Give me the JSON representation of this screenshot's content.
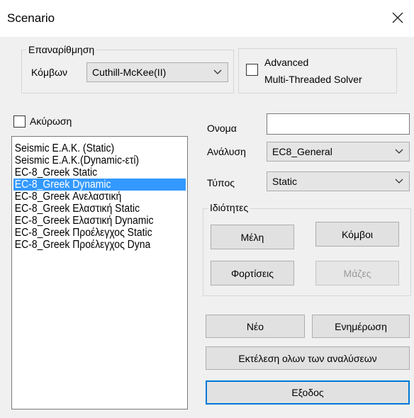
{
  "window": {
    "title": "Scenario"
  },
  "renumbering": {
    "legend": "Επαναρίθμηση",
    "nodes_label": "Κόμβων",
    "method_value": "Cuthill-McKee(II)"
  },
  "solver": {
    "line1": "Advanced",
    "line2": "Multi-Threaded Solver",
    "checked": false
  },
  "cancel_checkbox": {
    "label": "Ακύρωση",
    "checked": false
  },
  "scenarios": {
    "items": [
      "Seismic Ε.Α.Κ. (Static)",
      "Seismic Ε.Α.Κ.(Dynamic-ετί)",
      "EC-8_Greek Static",
      "EC-8_Greek Dynamic",
      "EC-8_Greek Ανελαστική",
      "EC-8_Greek Ελαστική Static",
      "EC-8_Greek Ελαστική Dynamic",
      "EC-8_Greek Προέλεγχος Static",
      "EC-8_Greek Προέλεγχος Dyna"
    ],
    "selected_index": 3
  },
  "form": {
    "name_label": "Ονομα",
    "name_value": "",
    "analysis_label": "Ανάλυση",
    "analysis_value": "EC8_General",
    "type_label": "Τύπος",
    "type_value": "Static"
  },
  "properties": {
    "legend": "Ιδιότητες",
    "members_button": "Μέλη",
    "nodes_button": "Κόμβοι",
    "loads_button": "Φορτίσεις",
    "masses_button": "Μάζες"
  },
  "actions": {
    "new_button": "Νέο",
    "update_button": "Ενημέρωση",
    "run_all_button": "Εκτέλεση ολων των αναλύσεων",
    "exit_button": "Εξοδος"
  }
}
